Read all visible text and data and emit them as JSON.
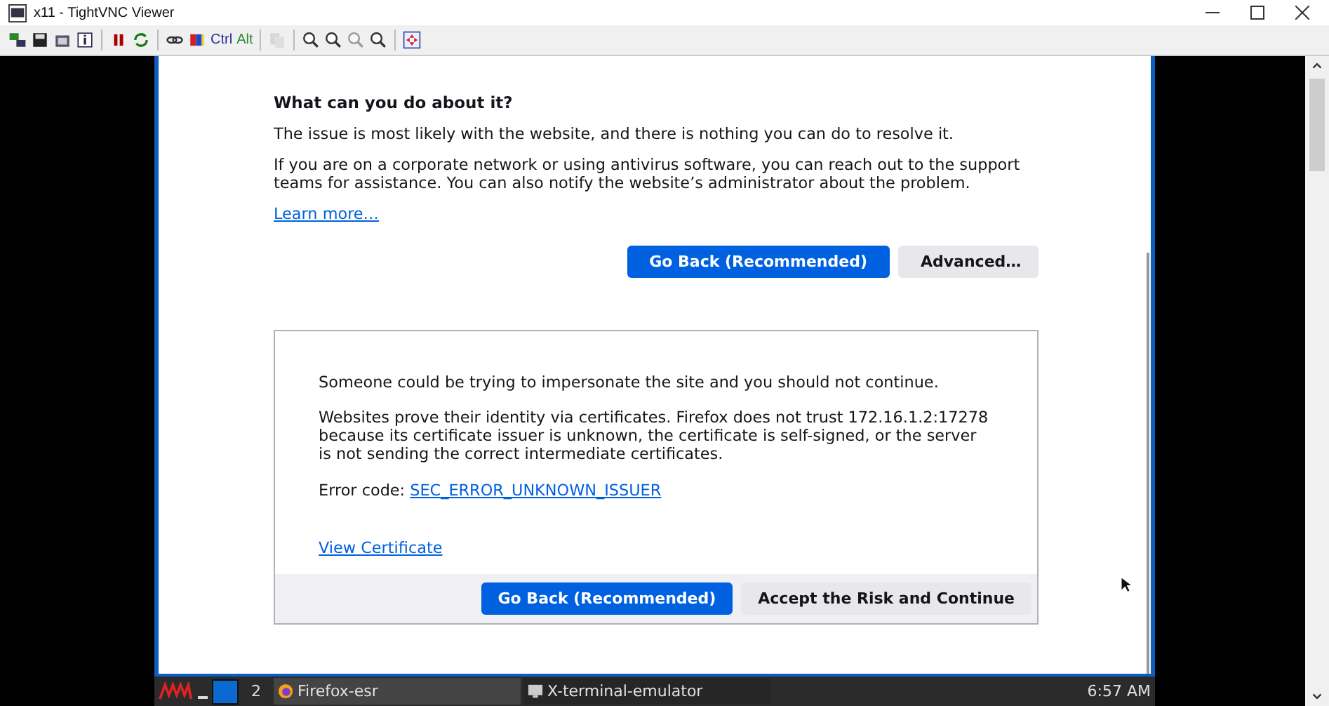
{
  "window": {
    "title": "x11 - TightVNC Viewer"
  },
  "toolbar": {
    "key_buttons": [
      "Ctrl",
      "Alt"
    ]
  },
  "page": {
    "heading": "What can you do about it?",
    "paragraphs": [
      "The issue is most likely with the website, and there is nothing you can do to resolve it.",
      "If you are on a corporate network or using antivirus software, you can reach out to the support teams for assistance. You can also notify the website’s administrator about the problem."
    ],
    "learn_more": "Learn more…",
    "buttons": [
      {
        "label": "Go Back (Recommended)",
        "kind": "primary"
      },
      {
        "label": "Advanced…",
        "kind": "secondary"
      }
    ]
  },
  "advanced_panel": {
    "warning": "Someone could be trying to impersonate the site and you should not continue.",
    "explanation": "Websites prove their identity via certificates. Firefox does not trust 172.16.1.2:17278 because its certificate issuer is unknown, the certificate is self-signed, or the server is not sending the correct intermediate certificates.",
    "error_label": "Error code:",
    "error_code": "SEC_ERROR_UNKNOWN_ISSUER",
    "view_certificate": "View Certificate",
    "buttons": [
      {
        "label": "Go Back (Recommended)",
        "kind": "primary"
      },
      {
        "label": "Accept the Risk and Continue",
        "kind": "secondary"
      }
    ]
  },
  "taskbar": {
    "workspace": "2",
    "tasks": [
      {
        "label": "Firefox-esr",
        "selected": true
      },
      {
        "label": "X-terminal-emulator",
        "selected": false
      }
    ],
    "clock": "6:57 AM"
  }
}
